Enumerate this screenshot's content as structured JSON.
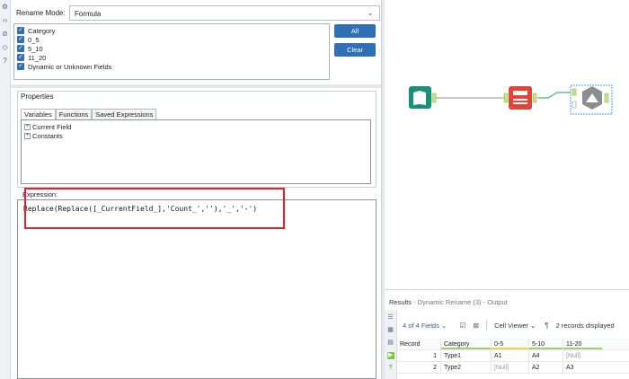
{
  "config": {
    "rename_mode_label": "Rename Mode:",
    "rename_mode_value": "Formula",
    "fields": [
      {
        "label": "Category",
        "checked": true
      },
      {
        "label": "0_5",
        "checked": true
      },
      {
        "label": "5_10",
        "checked": true
      },
      {
        "label": "11_20",
        "checked": true
      },
      {
        "label": "Dynamic or Unknown Fields",
        "checked": true
      }
    ],
    "all_button": "All",
    "clear_button": "Clear",
    "properties_title": "Properties",
    "tabs": [
      "Variables",
      "Functions",
      "Saved Expressions"
    ],
    "tree_items": [
      "Current Field",
      "Constants"
    ],
    "expression_label": "Expression:",
    "expression_text": "Replace(Replace([_CurrentField_],'Count_',''),'_','-')"
  },
  "results": {
    "title": "Results",
    "subtitle": " - Dynamic Rename (3) - Output",
    "fields_count": "4 of 4 Fields",
    "viewer": "Cell Viewer",
    "records_text": "2 records displayed",
    "columns": [
      "Record",
      "Category",
      "0-5",
      "5-10",
      "11-20"
    ],
    "rows": [
      [
        "1",
        "Type1",
        "A1",
        "A4",
        "[Null]"
      ],
      [
        "2",
        "Type2",
        "[Null]",
        "A2",
        "A3"
      ]
    ]
  },
  "colors": {
    "accent": "#2f6fb5",
    "highlight_red": "#e0242a",
    "input_tool": "#1a8f7a",
    "formula_tool": "#e0453a",
    "output_tool": "#888888"
  }
}
